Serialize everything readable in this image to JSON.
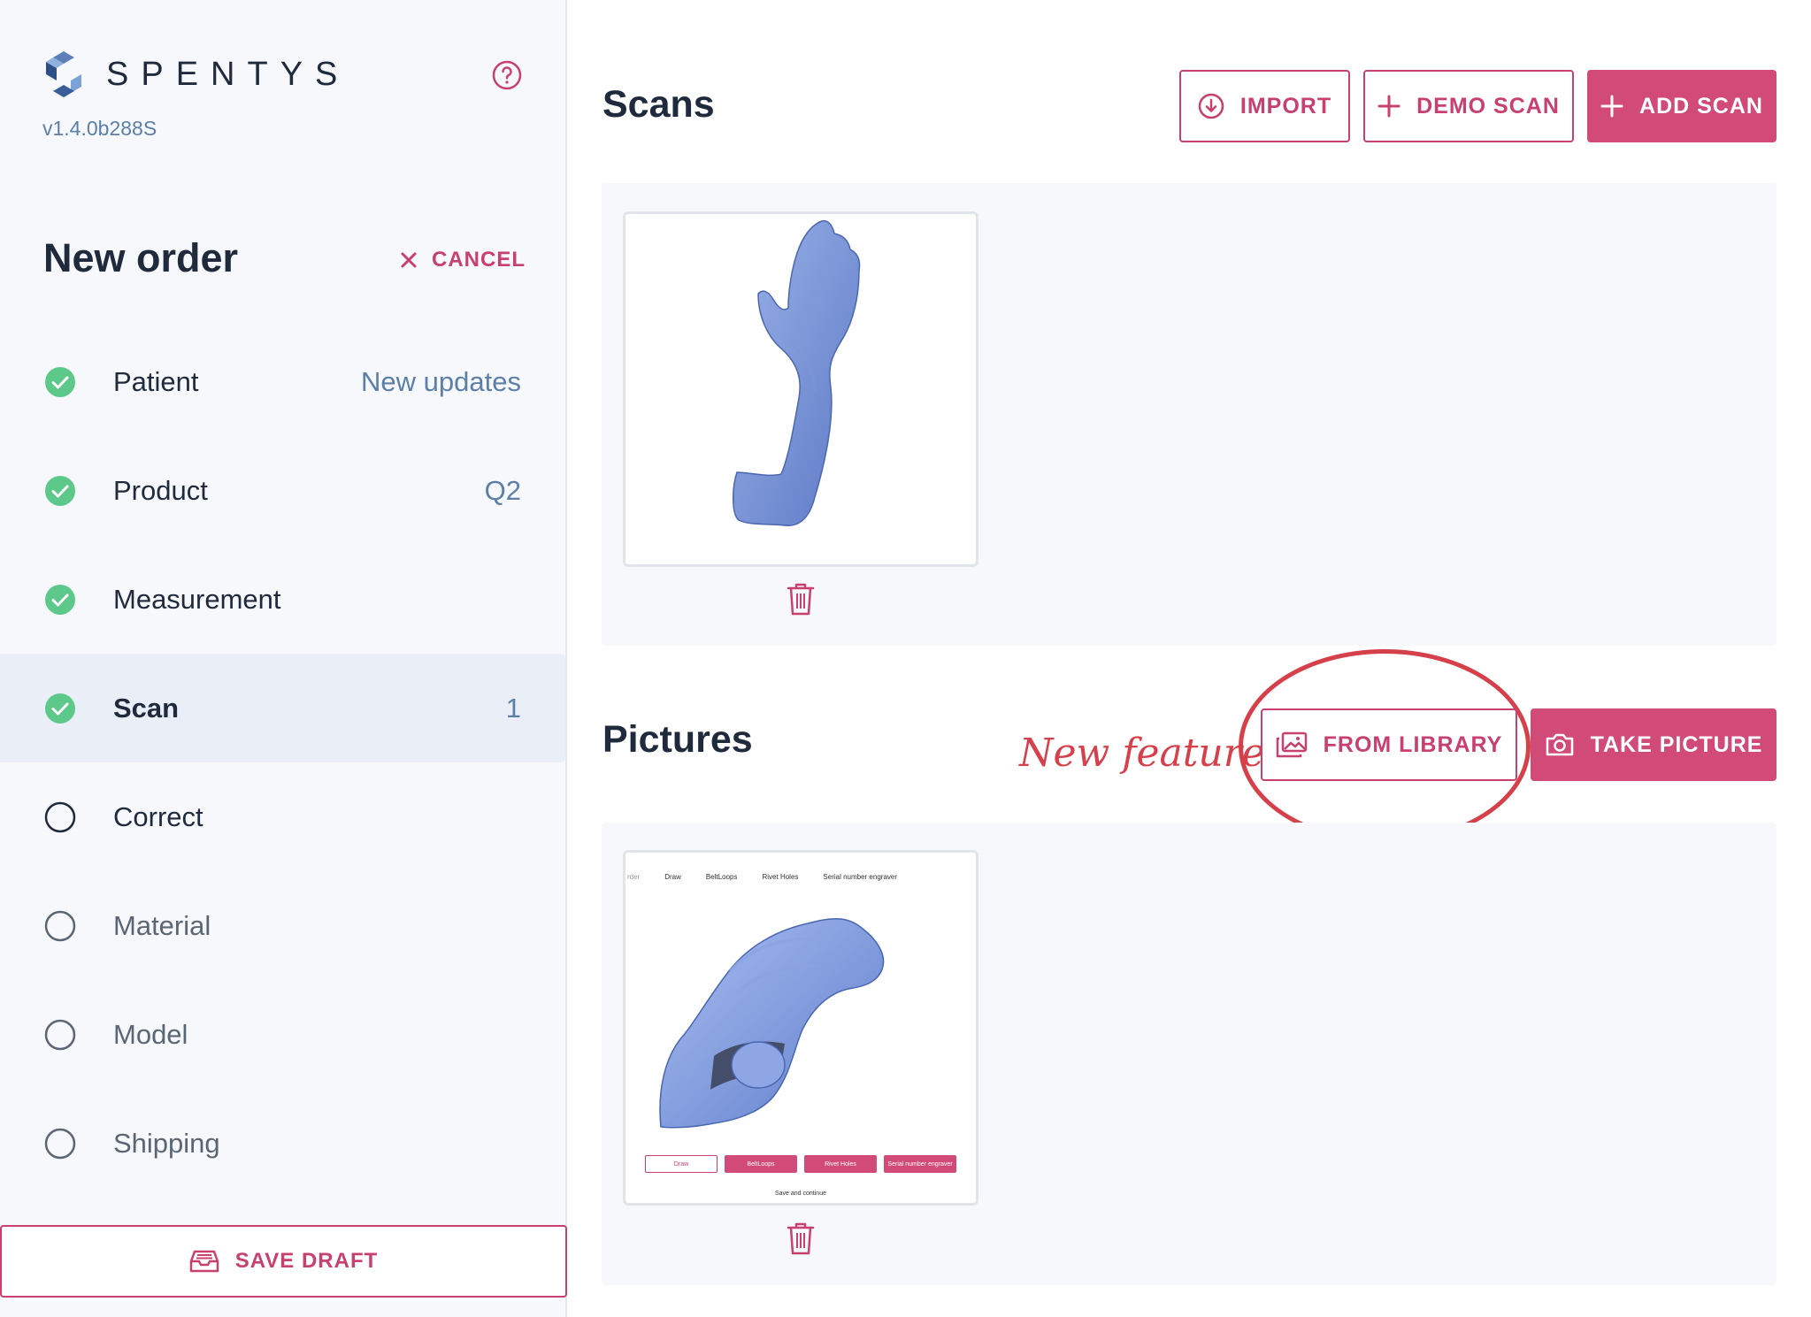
{
  "brand": {
    "name": "SPENTYS",
    "version": "v1.4.0b288S"
  },
  "order": {
    "title": "New order",
    "cancel_label": "CANCEL"
  },
  "steps": [
    {
      "label": "Patient",
      "meta": "New updates",
      "status": "done"
    },
    {
      "label": "Product",
      "meta": "Q2",
      "status": "done"
    },
    {
      "label": "Measurement",
      "meta": "",
      "status": "done"
    },
    {
      "label": "Scan",
      "meta": "1",
      "status": "done-active"
    },
    {
      "label": "Correct",
      "meta": "",
      "status": "current"
    },
    {
      "label": "Material",
      "meta": "",
      "status": "pending"
    },
    {
      "label": "Model",
      "meta": "",
      "status": "pending"
    },
    {
      "label": "Shipping",
      "meta": "",
      "status": "pending"
    }
  ],
  "save_draft_label": "SAVE DRAFT",
  "scans": {
    "title": "Scans",
    "import_label": "IMPORT",
    "demo_scan_label": "DEMO SCAN",
    "add_scan_label": "ADD SCAN"
  },
  "pictures": {
    "title": "Pictures",
    "from_library_label": "FROM LIBRARY",
    "take_picture_label": "TAKE PICTURE",
    "annotation": "New feature",
    "thumb_toolbar": [
      "rder",
      "Draw",
      "BeltLoops",
      "Rivet Holes",
      "Serial number engraver"
    ],
    "thumb_buttons": [
      "Draw",
      "BeltLoops",
      "Rivet Holes",
      "Serial number engraver"
    ],
    "thumb_save": "Save and continue"
  },
  "colors": {
    "accent": "#d14a78",
    "success": "#5cc98a",
    "annotation": "#d6404a",
    "muted_blue": "#5b7fa6"
  }
}
